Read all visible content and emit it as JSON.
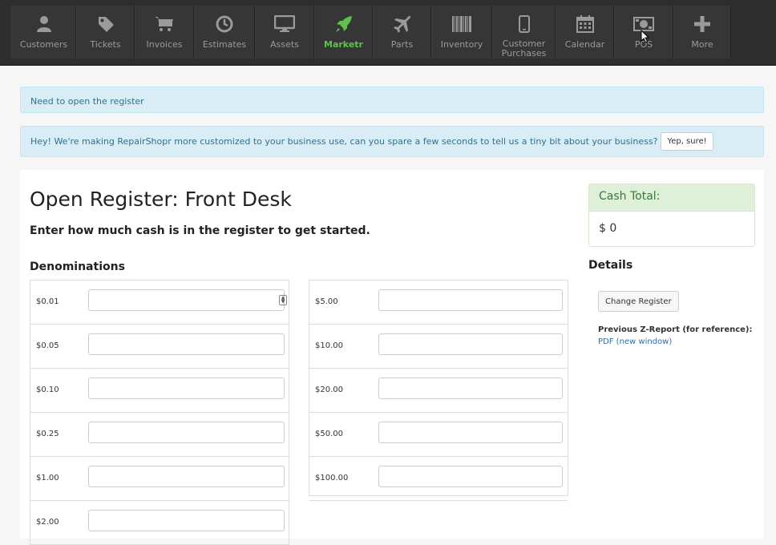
{
  "nav": {
    "items": [
      {
        "label": "Customers",
        "icon": "user-icon"
      },
      {
        "label": "Tickets",
        "icon": "tag-icon"
      },
      {
        "label": "Invoices",
        "icon": "cart-icon"
      },
      {
        "label": "Estimates",
        "icon": "clock-icon"
      },
      {
        "label": "Assets",
        "icon": "monitor-icon"
      },
      {
        "label": "Marketr",
        "icon": "rocket-icon",
        "active": true
      },
      {
        "label": "Parts",
        "icon": "plane-icon"
      },
      {
        "label": "Inventory",
        "icon": "barcode-icon"
      },
      {
        "label": "Customer\nPurchases",
        "icon": "phone-icon"
      },
      {
        "label": "Calendar",
        "icon": "calendar-icon"
      },
      {
        "label": "POS",
        "icon": "cash-icon"
      },
      {
        "label": "More",
        "icon": "plus-icon"
      }
    ],
    "active_color": "#5ec24d"
  },
  "alerts": {
    "register": "Need to open the register",
    "survey": "Hey! We're making RepairShopr more customized to your business use, can you spare a few seconds to tell us a tiny bit about your business?",
    "survey_button": "Yep, sure!"
  },
  "page": {
    "title": "Open Register: Front Desk",
    "subtitle": "Enter how much cash is in the register to get started."
  },
  "denominations": {
    "heading": "Denominations",
    "left": [
      "$0.01",
      "$0.05",
      "$0.10",
      "$0.25",
      "$1.00",
      "$2.00"
    ],
    "right": [
      "$5.00",
      "$10.00",
      "$20.00",
      "$50.00",
      "$100.00"
    ]
  },
  "cash_total": {
    "label": "Cash Total:",
    "value": "$ 0"
  },
  "details": {
    "heading": "Details",
    "change_button": "Change Register",
    "zreport_label": "Previous Z-Report (for reference):",
    "pdf_link": "PDF (new window)"
  }
}
